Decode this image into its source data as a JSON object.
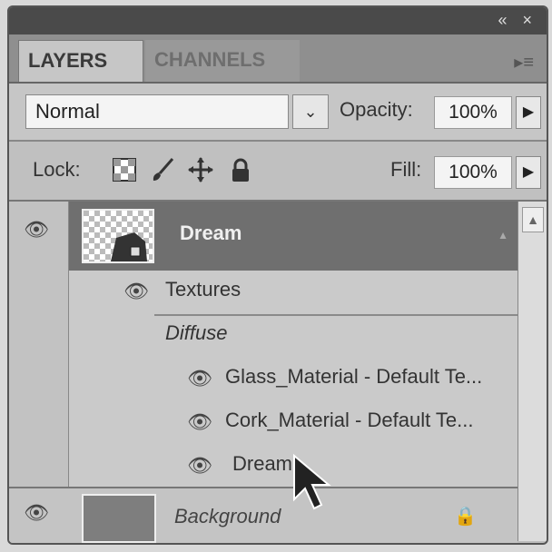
{
  "window": {
    "collapse_label": "«",
    "close_label": "×"
  },
  "tabs": [
    {
      "label": "LAYERS",
      "active": true
    },
    {
      "label": "CHANNELS",
      "active": false
    }
  ],
  "panel_menu_icon": "panel-menu-icon",
  "blend": {
    "mode": "Normal",
    "opacity_label": "Opacity:",
    "opacity_value": "100%"
  },
  "lock": {
    "label": "Lock:",
    "icons": [
      "lock-transparent-icon",
      "lock-brush-icon",
      "lock-move-icon",
      "lock-all-icon"
    ],
    "fill_label": "Fill:",
    "fill_value": "100%"
  },
  "layers": {
    "dream": {
      "name": "Dream"
    },
    "textures_label": "Textures",
    "diffuse_label": "Diffuse",
    "textures": [
      {
        "name": "Glass_Material - Default Te..."
      },
      {
        "name": "Cork_Material - Default Te..."
      },
      {
        "name": "Dream"
      }
    ],
    "background": {
      "name": "Background"
    }
  },
  "colors": {
    "selected_row": "#6f6f6f",
    "panel": "#bdbdbd"
  }
}
